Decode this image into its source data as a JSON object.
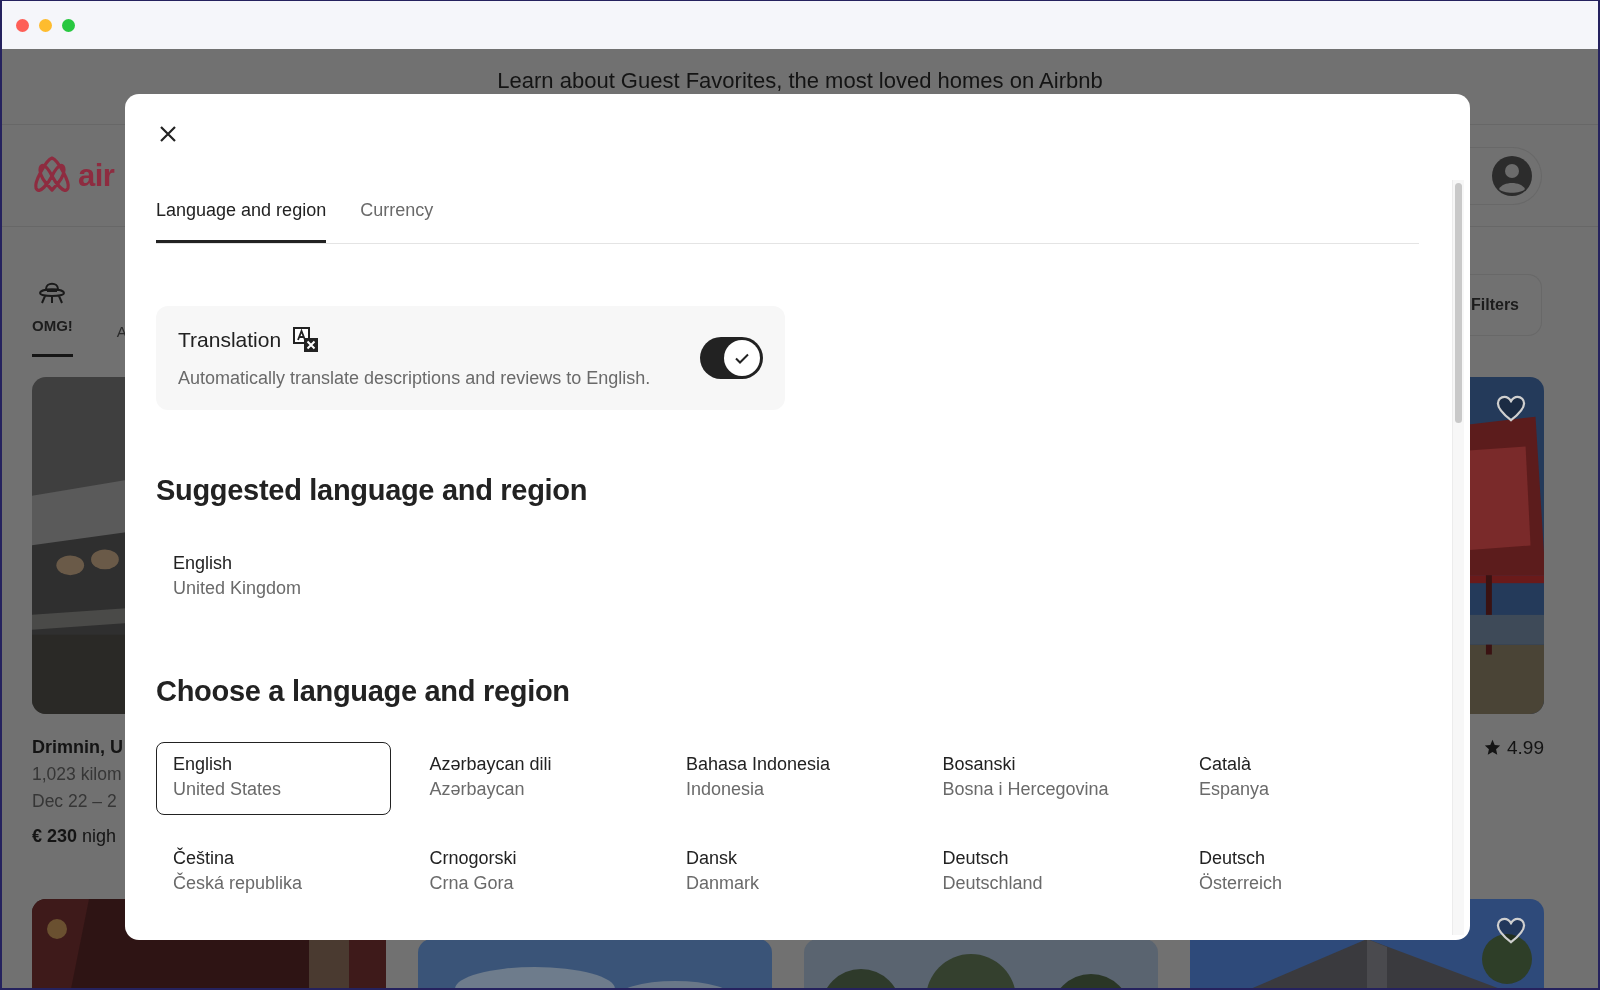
{
  "background_page": {
    "banner": "Learn about Guest Favorites, the most loved homes on Airbnb",
    "logo_text": "air",
    "categories": [
      {
        "label": "OMG!",
        "selected": true
      },
      {
        "label": "A",
        "selected": false
      }
    ],
    "filters_button": "Filters",
    "left_listing": {
      "title": "Drimnin, U",
      "distance": "1,023 kilom",
      "dates": "Dec 22 – 2",
      "price": "€ 230",
      "price_unit": "nigh"
    },
    "right_listing": {
      "rating": "4.99"
    }
  },
  "dialog": {
    "tabs": [
      {
        "label": "Language and region",
        "selected": true
      },
      {
        "label": "Currency",
        "selected": false
      }
    ],
    "translation": {
      "title": "Translation",
      "description": "Automatically translate descriptions and reviews to English.",
      "on": true
    },
    "suggested": {
      "heading": "Suggested language and region",
      "items": [
        {
          "language": "English",
          "region": "United Kingdom",
          "selected": false
        }
      ]
    },
    "choose": {
      "heading": "Choose a language and region",
      "items": [
        {
          "language": "English",
          "region": "United States",
          "selected": true
        },
        {
          "language": "Azərbaycan dili",
          "region": "Azərbaycan",
          "selected": false
        },
        {
          "language": "Bahasa Indonesia",
          "region": "Indonesia",
          "selected": false
        },
        {
          "language": "Bosanski",
          "region": "Bosna i Hercegovina",
          "selected": false
        },
        {
          "language": "Català",
          "region": "Espanya",
          "selected": false
        },
        {
          "language": "Čeština",
          "region": "Česká republika",
          "selected": false
        },
        {
          "language": "Crnogorski",
          "region": "Crna Gora",
          "selected": false
        },
        {
          "language": "Dansk",
          "region": "Danmark",
          "selected": false
        },
        {
          "language": "Deutsch",
          "region": "Deutschland",
          "selected": false
        },
        {
          "language": "Deutsch",
          "region": "Österreich",
          "selected": false
        }
      ]
    }
  }
}
